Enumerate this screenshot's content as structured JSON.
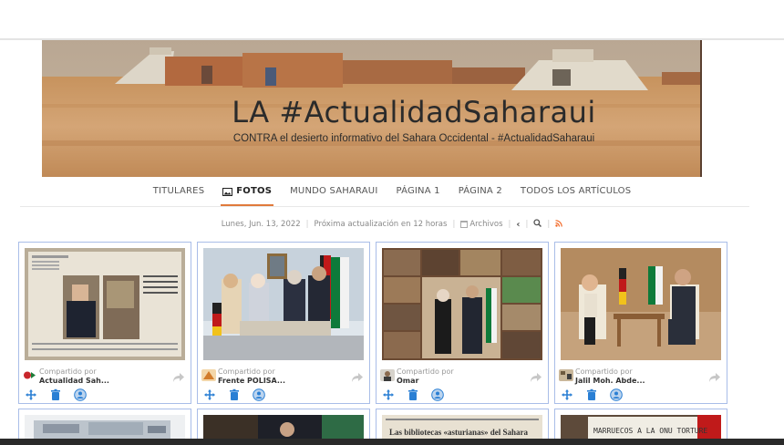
{
  "banner": {
    "title": "LA #ActualidadSaharaui",
    "subtitle": "CONTRA el desierto informativo del Sahara Occidental - #ActualidadSaharaui"
  },
  "nav": {
    "items": [
      {
        "label": "TITULARES",
        "active": false
      },
      {
        "label": "FOTOS",
        "active": true,
        "icon": "image-icon"
      },
      {
        "label": "MUNDO SAHARAUI",
        "active": false
      },
      {
        "label": "PÁGINA 1",
        "active": false
      },
      {
        "label": "PÁGINA 2",
        "active": false
      },
      {
        "label": "TODOS LOS ARTÍCULOS",
        "active": false
      }
    ]
  },
  "meta": {
    "date": "Lunes, Jun. 13, 2022",
    "next_update": "Próxima actualización en 12 horas",
    "archives": "Archivos"
  },
  "cards": [
    {
      "shared_label": "Compartido por",
      "author": "Actualidad Sah..."
    },
    {
      "shared_label": "Compartido por",
      "author": "Frente POLISA..."
    },
    {
      "shared_label": "Compartido por",
      "author": "Omar"
    },
    {
      "shared_label": "Compartido por",
      "author": "Jalil Moh. Abde..."
    }
  ],
  "second_row": {
    "card3_headline": "Las bibliotecas «asturianas» del Sahara",
    "card4_sign": "MARRUECOS A LA ONU TORTURE"
  },
  "colors": {
    "accent": "#e07a3b",
    "card_border": "#a9bde8",
    "action_blue": "#2a7fd4"
  }
}
